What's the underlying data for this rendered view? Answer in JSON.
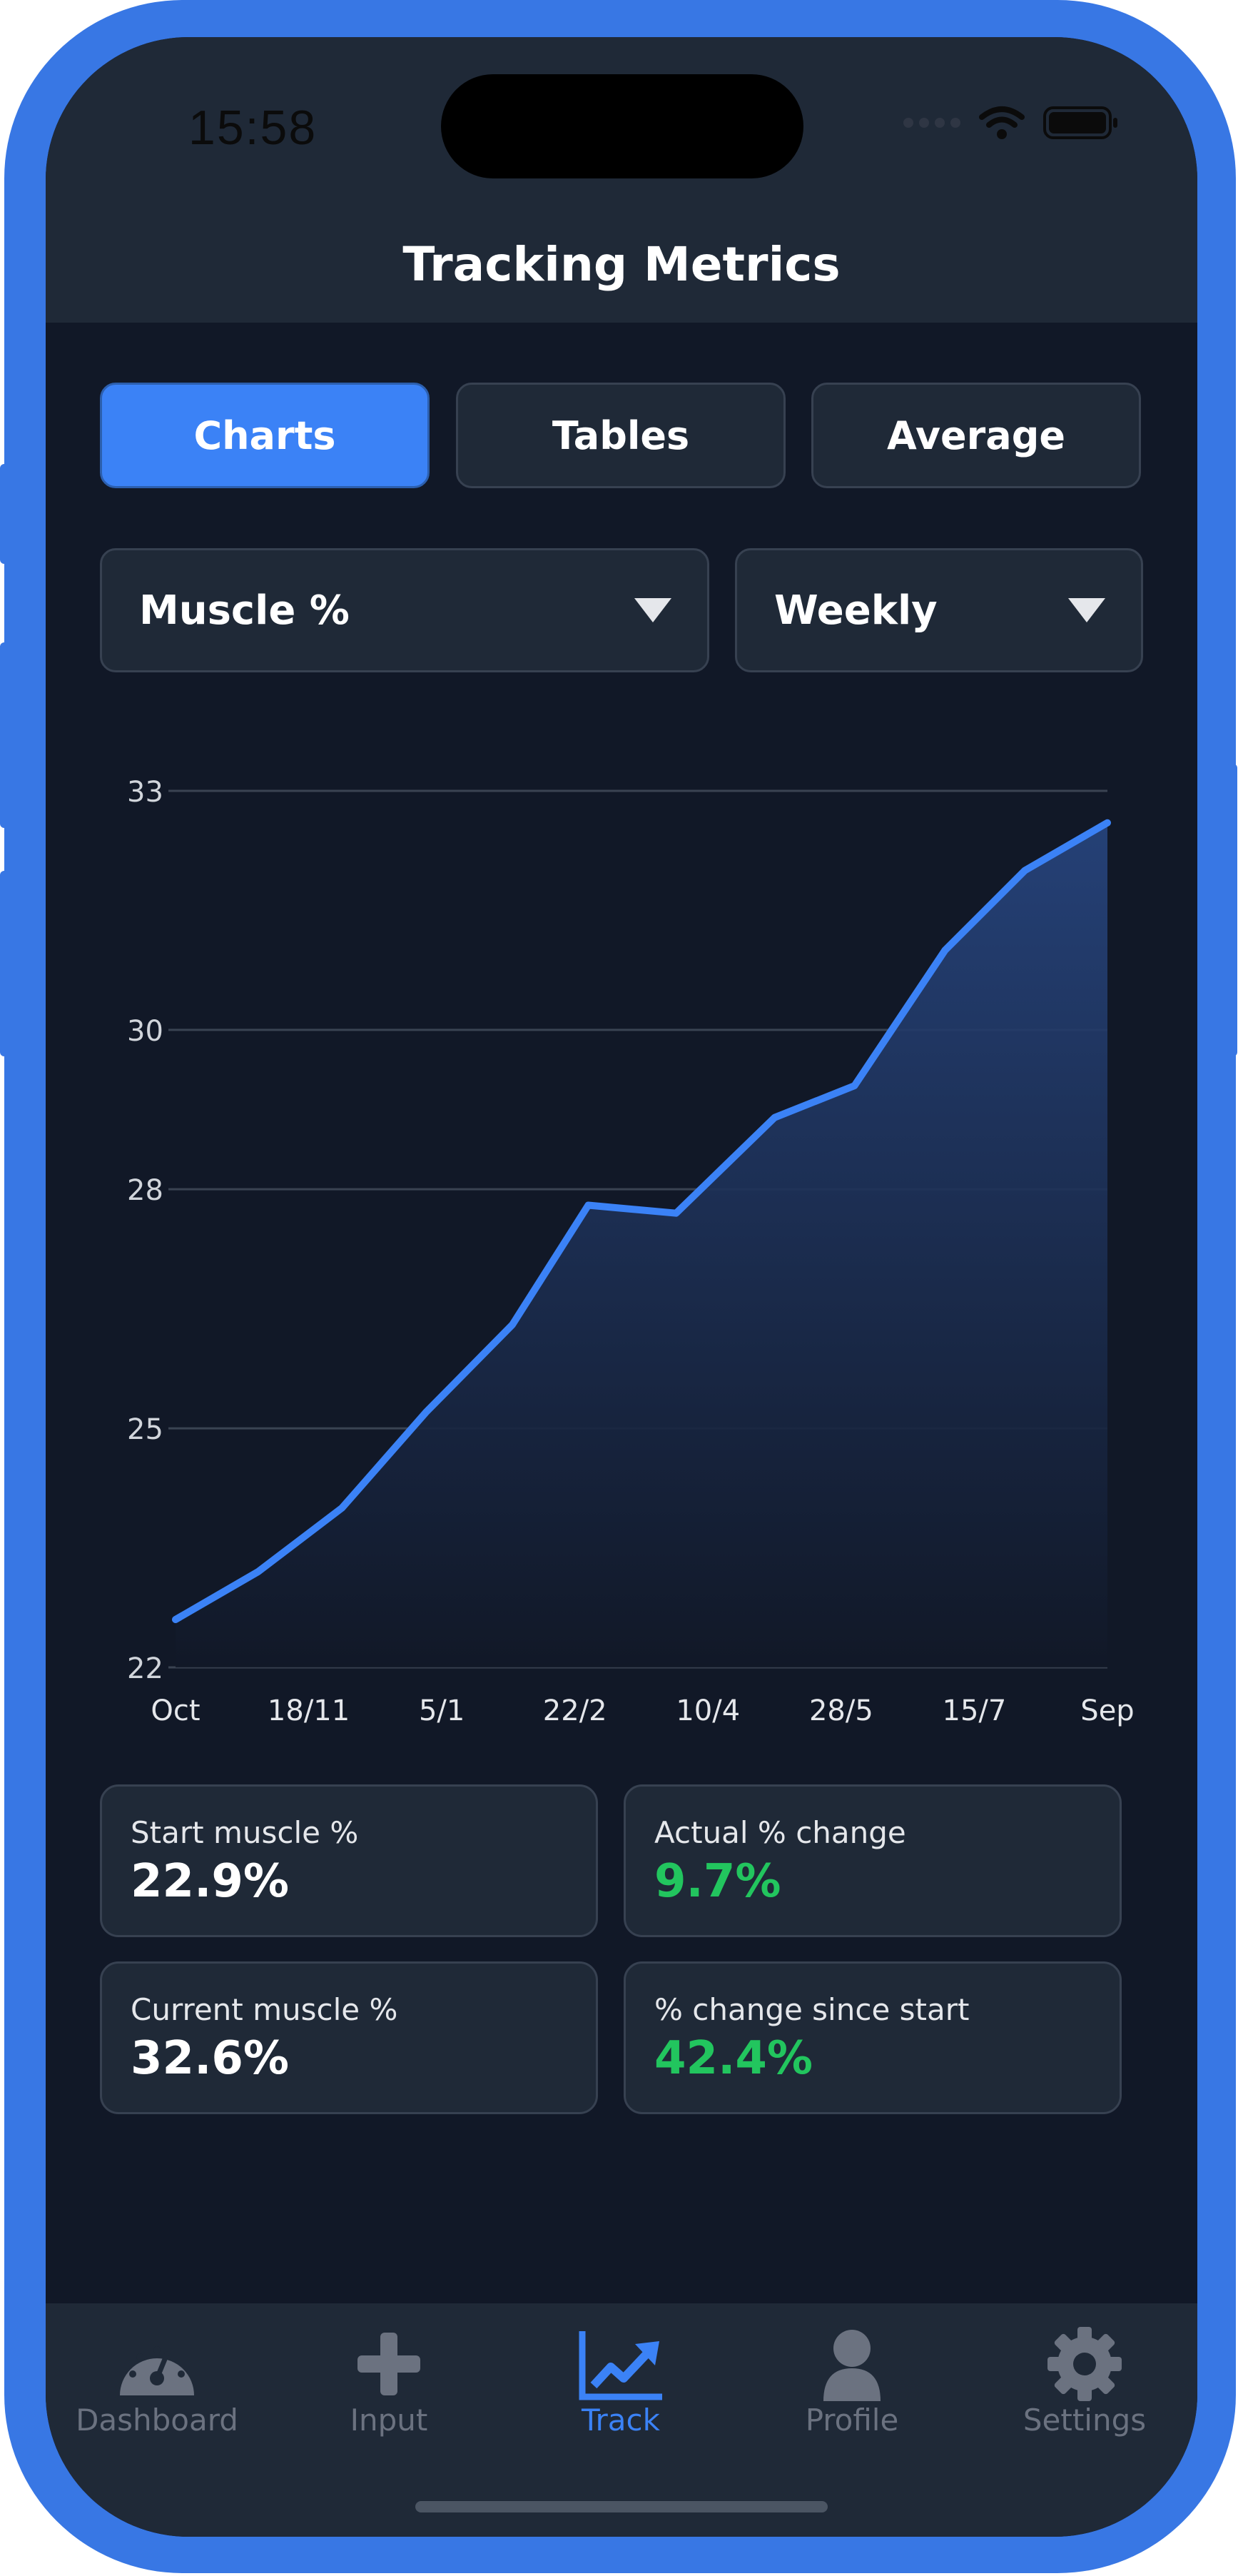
{
  "status_bar": {
    "time": "15:58"
  },
  "header": {
    "title": "Tracking Metrics"
  },
  "view_tabs": [
    {
      "label": "Charts",
      "active": true
    },
    {
      "label": "Tables",
      "active": false
    },
    {
      "label": "Average",
      "active": false
    }
  ],
  "filters": {
    "metric": {
      "selected": "Muscle %"
    },
    "period": {
      "selected": "Weekly"
    }
  },
  "chart_data": {
    "type": "area",
    "title": "",
    "xlabel": "",
    "ylabel": "",
    "ylim": [
      22,
      33
    ],
    "yticks": [
      "33",
      "30",
      "28",
      "25",
      "22"
    ],
    "xticks": [
      "Oct",
      "18/11",
      "5/1",
      "22/2",
      "10/4",
      "28/5",
      "15/7",
      "Sep"
    ],
    "grid": true,
    "line_color": "#3b82f6",
    "series": [
      {
        "x_index": [
          0,
          0.62,
          1.25,
          1.88,
          2.53,
          3.1,
          3.76,
          4.5,
          5.1,
          5.78,
          6.38,
          7.0
        ],
        "values": [
          22.6,
          23.2,
          24.0,
          25.2,
          26.3,
          27.8,
          27.7,
          28.9,
          29.3,
          31.0,
          32.0,
          32.6
        ]
      }
    ]
  },
  "stats": [
    {
      "label": "Start muscle %",
      "value": "22.9%",
      "color": "#ffffff"
    },
    {
      "label": "Actual % change",
      "value": "9.7%",
      "color": "#22c55e"
    },
    {
      "label": "Current muscle %",
      "value": "32.6%",
      "color": "#ffffff"
    },
    {
      "label": "% change since start",
      "value": "42.4%",
      "color": "#22c55e"
    }
  ],
  "tabbar": [
    {
      "label": "Dashboard",
      "icon": "gauge-icon",
      "active": false
    },
    {
      "label": "Input",
      "icon": "plus-icon",
      "active": false
    },
    {
      "label": "Track",
      "icon": "trend-chart-icon",
      "active": true
    },
    {
      "label": "Profile",
      "icon": "person-icon",
      "active": false
    },
    {
      "label": "Settings",
      "icon": "gear-icon",
      "active": false
    }
  ],
  "colors": {
    "accent": "#3b82f6",
    "background": "#111827",
    "surface": "#1f2937",
    "positive": "#22c55e",
    "frame": "#3877e4"
  }
}
